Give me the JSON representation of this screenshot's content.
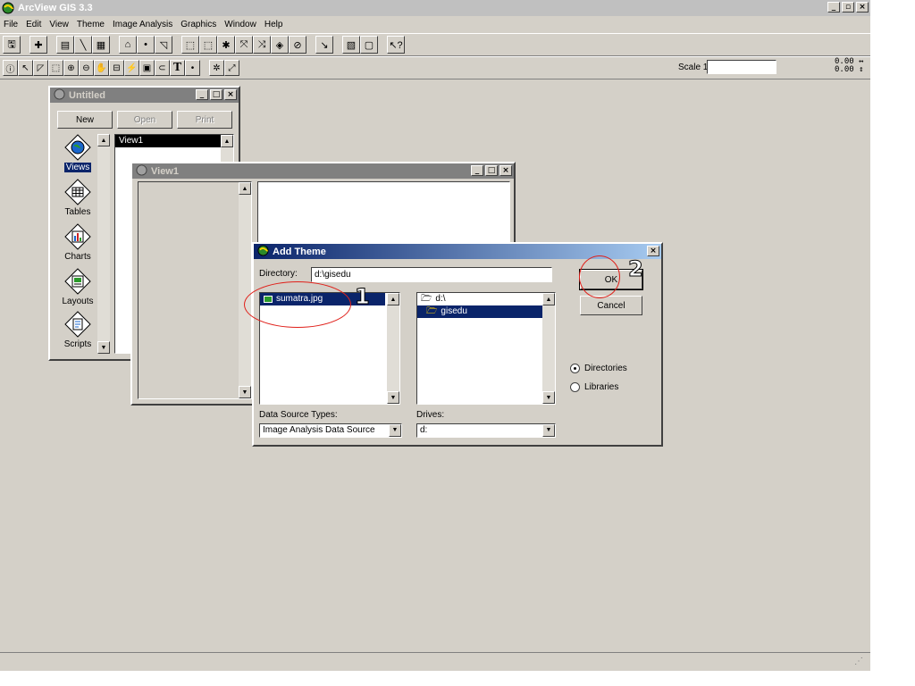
{
  "app": {
    "title": "ArcView GIS 3.3",
    "menu": [
      "File",
      "Edit",
      "View",
      "Theme",
      "Image Analysis",
      "Graphics",
      "Window",
      "Help"
    ],
    "scale_label": "Scale 1:",
    "scale_value": "",
    "coord_x": "0.00",
    "coord_y": "0.00"
  },
  "project": {
    "title": "Untitled",
    "buttons": {
      "new": "New",
      "open": "Open",
      "print": "Print"
    },
    "doc_types": [
      "Views",
      "Tables",
      "Charts",
      "Layouts",
      "Scripts"
    ],
    "selected_doc_type": "Views",
    "items": [
      "View1"
    ]
  },
  "view": {
    "title": "View1"
  },
  "dialog": {
    "title": "Add Theme",
    "directory_label": "Directory:",
    "directory_value": "d:\\gisedu",
    "files": [
      "sumatra.jpg"
    ],
    "dirs": [
      "d:\\",
      "gisedu"
    ],
    "ok_label": "OK",
    "cancel_label": "Cancel",
    "radio_directories": "Directories",
    "radio_libraries": "Libraries",
    "data_source_label": "Data Source Types:",
    "data_source_value": "Image Analysis Data Source",
    "drives_label": "Drives:",
    "drives_value": "d:"
  },
  "annotations": {
    "step1": "1",
    "step2": "2",
    "color": "#e0201a"
  },
  "colors": {
    "active_title": "#0a246a",
    "window_bg": "#d4d0c8"
  }
}
